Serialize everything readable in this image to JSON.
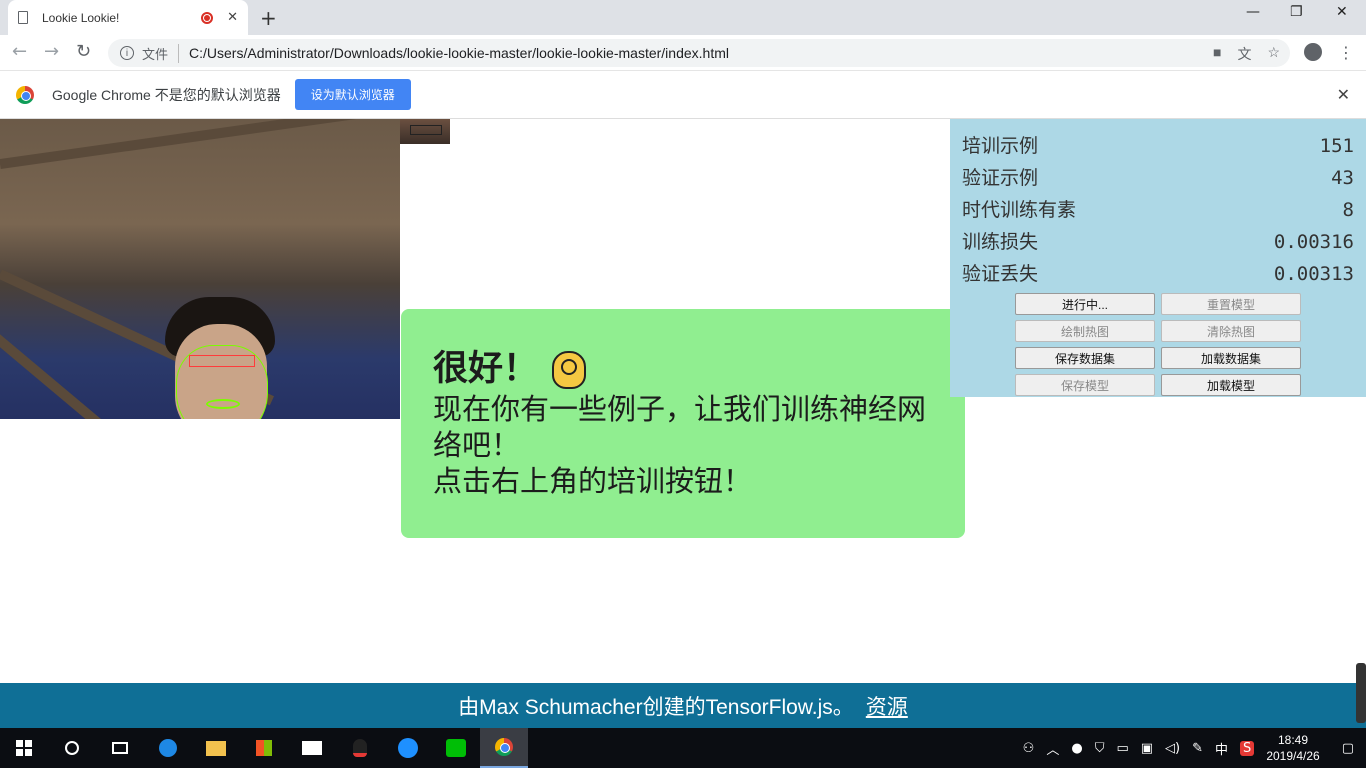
{
  "browser": {
    "tab_title": "Lookie Lookie!",
    "tab_close": "✕",
    "new_tab": "+",
    "window_controls": {
      "minimize": "—",
      "restore": "❐",
      "close": "✕"
    },
    "nav": {
      "back": "←",
      "forward": "→",
      "reload": "↻"
    },
    "address_label": "文件",
    "address": "C:/Users/Administrator/Downloads/lookie-lookie-master/lookie-lookie-master/index.html",
    "omnibox_icons": {
      "camera": "■",
      "translate": "文",
      "bookmark": "☆"
    },
    "menu": "⋮"
  },
  "infobar": {
    "message": "Google Chrome 不是您的默认浏览器",
    "button": "设为默认浏览器",
    "close": "✕"
  },
  "message": {
    "heading": "很好！",
    "line1": "现在你有一些例子，让我们训练神经网络吧！",
    "line2": "点击右上角的培训按钮！"
  },
  "stats": [
    {
      "label": "培训示例",
      "value": "151"
    },
    {
      "label": "验证示例",
      "value": "43"
    },
    {
      "label": "时代训练有素",
      "value": "8"
    },
    {
      "label": "训练损失",
      "value": "0.00316"
    },
    {
      "label": "验证丢失",
      "value": "0.00313"
    }
  ],
  "buttons": {
    "train": "进行中...",
    "reset_model": "重置模型",
    "draw_heatmap": "绘制热图",
    "clear_heatmap": "清除热图",
    "save_dataset": "保存数据集",
    "load_dataset": "加载数据集",
    "save_model": "保存模型",
    "load_model": "加载模型"
  },
  "footer": {
    "text": "由Max Schumacher创建的TensorFlow.js。",
    "link": "资源"
  },
  "taskbar": {
    "tray_lang": "中",
    "time": "18:49",
    "date": "2019/4/26"
  }
}
